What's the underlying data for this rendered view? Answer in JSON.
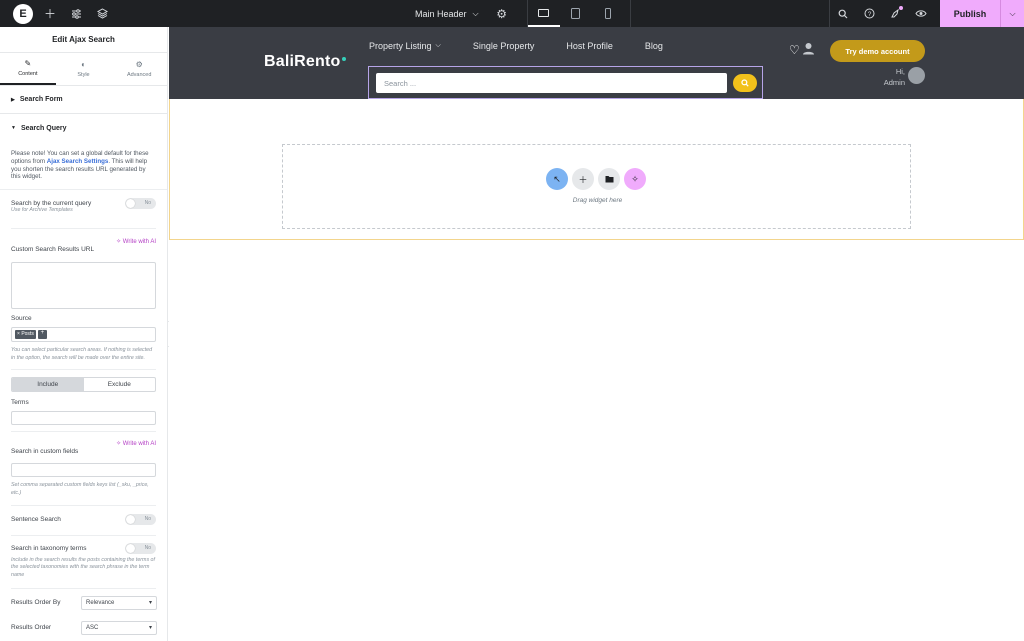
{
  "colors": {
    "topbar": "#1f2124",
    "publish": "#f0abfc",
    "accent_ai": "#b43fc5",
    "header_bg": "#3a3d44",
    "demo_btn": "#c39a1a",
    "search_btn": "#f2c11b",
    "brand_dot": "#35d0ba"
  },
  "topbar": {
    "logo": "E",
    "document_name": "Main Header",
    "publish_label": "Publish"
  },
  "panel": {
    "title": "Edit Ajax Search",
    "tabs": [
      {
        "label": "Content",
        "icon": "pencil-icon"
      },
      {
        "label": "Style",
        "icon": "contrast-icon"
      },
      {
        "label": "Advanced",
        "icon": "gear-icon"
      }
    ],
    "sections": {
      "search_form": "Search Form",
      "search_query": "Search Query"
    },
    "note_prefix": "Please note! You can set a global default for these options from ",
    "note_link": "Ajax Search Settings",
    "note_suffix": ". This will help you shorten the search results URL generated by this widget.",
    "current_query": {
      "label": "Search by the current query",
      "toggle": "No",
      "help": "Use for Archive Templates"
    },
    "custom_url": {
      "label": "Custom Search Results URL",
      "ai": "Write with AI"
    },
    "source": {
      "label": "Source",
      "tag": "Posts",
      "add": "+",
      "help": "You can select particular search areas. If nothing is selected in the option, the search will be made over the entire site."
    },
    "include_exclude": {
      "include": "Include",
      "exclude": "Exclude"
    },
    "terms": {
      "label": "Terms"
    },
    "custom_fields": {
      "label": "Search in custom fields",
      "ai": "Write with AI",
      "help": "Set comma separated custom fields keys list (_sku, _price, etc.)"
    },
    "sentence_search": {
      "label": "Sentence Search",
      "toggle": "No"
    },
    "taxonomy_terms": {
      "label": "Search in taxonomy terms",
      "toggle": "No",
      "help": "Include in the search results the posts containing the terms of the selected taxonomies with the search phrase in the term name"
    },
    "order_by": {
      "label": "Results Order By",
      "value": "Relevance"
    },
    "order": {
      "label": "Results Order",
      "value": "ASC"
    }
  },
  "site": {
    "brand": "BaliRento",
    "nav": [
      "Property Listing",
      "Single Property",
      "Host Profile",
      "Blog"
    ],
    "search_placeholder": "Search ...",
    "demo_button": "Try demo account",
    "greeting_line1": "Hi,",
    "greeting_line2": "Admin",
    "drag_text": "Drag widget here"
  }
}
